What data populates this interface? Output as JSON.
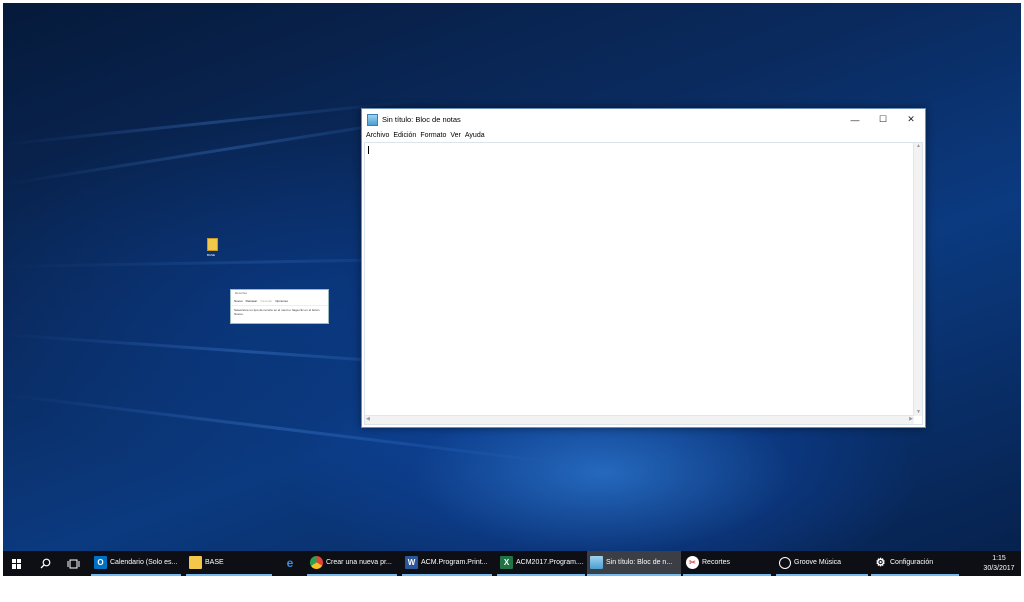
{
  "desktop": {
    "icon_label": "BASE"
  },
  "snipping_tool": {
    "title": "Recortes",
    "buttons": [
      "Nuevo",
      "Retrasar",
      "Cancelar",
      "Opciones"
    ],
    "message": "Seleccione un tipo de recorte en el menú o haga clic en el botón Nuevo."
  },
  "notepad": {
    "title": "Sin título: Bloc de notas",
    "controls": {
      "minimize": "—",
      "maximize": "☐",
      "close": "✕"
    },
    "menu": [
      "Archivo",
      "Edición",
      "Formato",
      "Ver",
      "Ayuda"
    ],
    "text": ""
  },
  "taskbar": {
    "items": [
      {
        "label": "Calendario (Solo es...",
        "icon": "outlook-icon",
        "color": "#0072c6"
      },
      {
        "label": "BASE",
        "icon": "folder-icon",
        "color": "#f3c74a"
      },
      {
        "label": "",
        "icon": "edge-icon",
        "color": "#3277bc"
      },
      {
        "label": "Crear una nueva pr...",
        "icon": "chrome-icon",
        "color": "#e0453a"
      },
      {
        "label": "ACM.Program.Print...",
        "icon": "word-icon",
        "color": "#2b579a"
      },
      {
        "label": "ACM2017.Program....",
        "icon": "excel-icon",
        "color": "#217346"
      },
      {
        "label": "Sin título: Bloc de n...",
        "icon": "notepad-icon",
        "color": "#5aa9de"
      },
      {
        "label": "Recortes",
        "icon": "snipping-tool-icon",
        "color": "#d9534f"
      },
      {
        "label": "Groove Música",
        "icon": "groove-icon",
        "color": "#ffffff"
      },
      {
        "label": "Configuración",
        "icon": "gear-icon",
        "color": "#ffffff"
      }
    ],
    "clock": {
      "time": "1:15",
      "date": "30/3/2017"
    }
  }
}
